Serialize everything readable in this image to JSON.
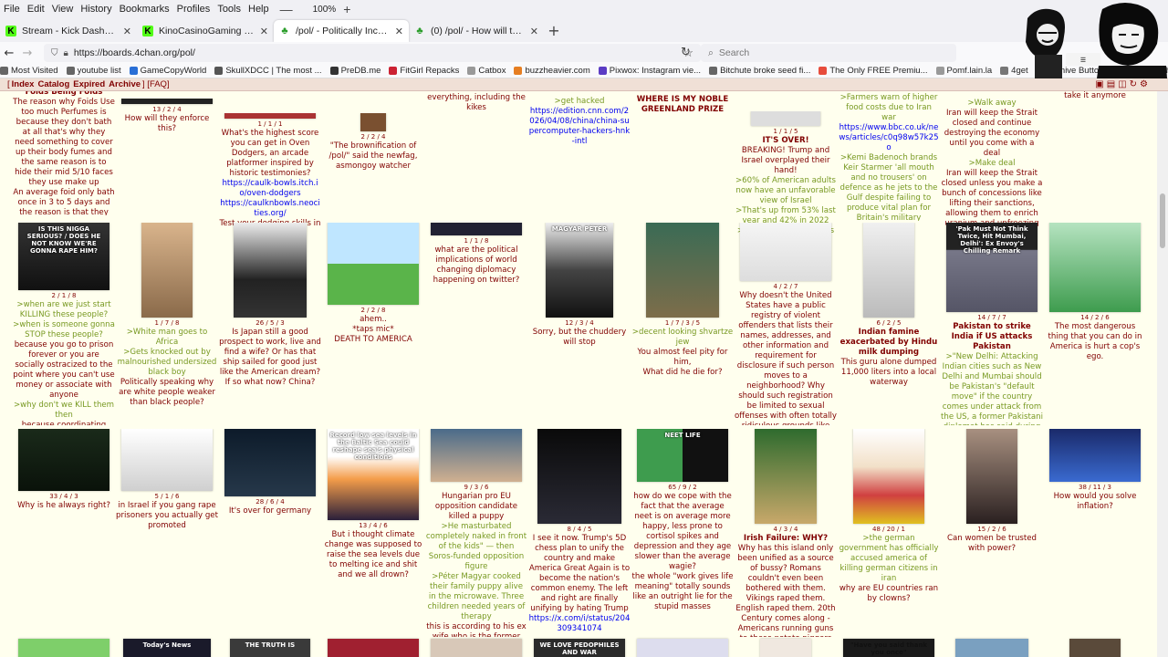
{
  "menubar": {
    "items": [
      "File",
      "Edit",
      "View",
      "History",
      "Bookmarks",
      "Profiles",
      "Tools",
      "Help"
    ],
    "zoom": "100%",
    "zoom_plus": "+"
  },
  "tabs": [
    {
      "title": "Stream - Kick Dashboard",
      "icon": "kick-icon"
    },
    {
      "title": "KinoCasinoGaming - Watch the",
      "icon": "kick-icon"
    },
    {
      "title": "/pol/ - Politically Incorrect - 4ch",
      "icon": "clover-icon",
      "active": true
    },
    {
      "title": "(0) /pol/ - How will they enforce",
      "icon": "clover-icon"
    }
  ],
  "newtab": "+",
  "navbar": {
    "url": "https://boards.4chan.org/pol/",
    "search_placeholder": "Search"
  },
  "bookmarks": [
    {
      "label": "Most Visited",
      "color": "#666666"
    },
    {
      "label": "youtube list",
      "color": "#666666"
    },
    {
      "label": "GameCopyWorld",
      "color": "#2a6fd6"
    },
    {
      "label": "SkullXDCC | The most ...",
      "color": "#555555"
    },
    {
      "label": "PreDB.me",
      "color": "#333333"
    },
    {
      "label": "FitGirl Repacks",
      "color": "#c23"
    },
    {
      "label": "Catbox",
      "color": "#999"
    },
    {
      "label": "buzzheavier.com",
      "color": "#e67e22"
    },
    {
      "label": "Pixwox: Instagram vie...",
      "color": "#5b3cc4"
    },
    {
      "label": "Bitchute broke seed fi...",
      "color": "#666"
    },
    {
      "label": "The Only FREE Premiu...",
      "color": "#e74c3c"
    },
    {
      "label": "Pomf.lain.la",
      "color": "#999"
    },
    {
      "label": "4get",
      "color": "#777"
    },
    {
      "label": "Archive Buttons | Free ...",
      "color": "#c0392b"
    },
    {
      "label": "chon",
      "color": "#555"
    }
  ],
  "boardnav": {
    "open": "[",
    "links": [
      "Index",
      "Catalog",
      "Expired",
      "Archive"
    ],
    "sep": "] [",
    "faq": "FAQ",
    "close": "]"
  },
  "catalog": {
    "row1": [
      {
        "meta": "",
        "lines": [
          [
            "s",
            "Foids Being Foids"
          ],
          [
            "t",
            "The reason why Foids Use too much Perfumes is because they don't bath at all that's why they need something to cover up their body fumes and the same reason is to hide their mid 5/10 faces they use make up"
          ],
          [
            "t",
            "An average foid only bath once in 3 to 5 days and the reason is that they don't"
          ]
        ]
      },
      {
        "meta": "13 / 2 / 4",
        "lines": [
          [
            "t",
            "How will they enforce this?"
          ]
        ]
      },
      {
        "meta": "1 / 1 / 1",
        "lines": [
          [
            "t",
            "What's the highest score you can get in Oven Dodgers, an arcade platformer inspired by historic testimonies?"
          ],
          [
            "l",
            "https://caulk-bowls.itch.io/oven-dodgers"
          ],
          [
            "l",
            "https://caulknbowls.neocities.org/"
          ],
          [
            "t",
            "Test your dodging skills in"
          ]
        ]
      },
      {
        "meta": "2 / 2 / 4",
        "lines": [
          [
            "t",
            "\"The brownification of /pol/\" said the newfag, asmongoy watcher"
          ]
        ]
      },
      {
        "meta": "",
        "lines": [
          [
            "t",
            "everything, including the kikes"
          ]
        ]
      },
      {
        "meta": "",
        "lines": [
          [
            "g",
            ">get hacked"
          ],
          [
            "l",
            "https://edition.cnn.com/2026/04/08/china/china-supercomputer-hackers-hnk-intl"
          ]
        ]
      },
      {
        "meta": "",
        "lines": [
          [
            "s",
            "WHERE IS MY NOBLE GREENLAND PRIZE"
          ]
        ]
      },
      {
        "meta": "1 / 1 / 5",
        "lines": [
          [
            "s",
            "IT'S OVER!"
          ],
          [
            "t",
            "BREAKING! Trump and Israel overplayed their hand!"
          ],
          [
            "g",
            ">60% of American adults now have an unfavorable view of Israel"
          ],
          [
            "g",
            ">That's up from 53% last year and 42% in 2022"
          ],
          [
            "g",
            ">In both political parties"
          ]
        ]
      },
      {
        "meta": "",
        "lines": [
          [
            "g",
            ">Farmers warn of higher food costs due to Iran war"
          ],
          [
            "l",
            "https://www.bbc.co.uk/news/articles/c0q98w57k25o"
          ],
          [
            "g",
            ">Kemi Badenoch brands Keir Starmer 'all mouth and no trousers' on defence as he jets to the Gulf despite failing to produce vital plan for Britain's military"
          ],
          [
            "l",
            "https://www.dailymail.co.uk/news/"
          ]
        ]
      },
      {
        "meta": "",
        "lines": [
          [
            "g",
            ">Walk away"
          ],
          [
            "t",
            "Iran will keep the Strait closed and continue destroying the economy until you come with a deal"
          ],
          [
            "g",
            ">Make deal"
          ],
          [
            "t",
            "Iran will keep the Strait closed unless you make a bunch of concessions like lifting their sanctions, allowing them to enrich uranium and unfreezing"
          ]
        ]
      },
      {
        "meta": "",
        "lines": [
          [
            "t",
            "take it anymore"
          ]
        ]
      }
    ],
    "row2": [
      {
        "meta": "2 / 1 / 8",
        "thumb_text": "IS THIS NIGGA SERIOUS? / DOES HE NOT KNOW WE'RE GONNA RAPE HIM?",
        "lines": [
          [
            "g",
            ">when are we just start KILLING these people?"
          ],
          [
            "g",
            ">when is someone gonna STOP these people?"
          ],
          [
            "t",
            "because you go to prison forever or you are socially ostracized to the point where you can't use money or associate with anyone"
          ],
          [
            "g",
            ">why don't we KILL them then"
          ],
          [
            "t",
            "because coordinating"
          ]
        ]
      },
      {
        "meta": "1 / 7 / 8",
        "thumb_text": "",
        "lines": [
          [
            "g",
            ">White man goes to Africa"
          ],
          [
            "g",
            ">Gets knocked out by malnourished undersized black boy"
          ],
          [
            "t",
            "Politically speaking why are white people weaker than black people?"
          ]
        ]
      },
      {
        "meta": "26 / 5 / 3",
        "thumb_text": "",
        "lines": [
          [
            "t",
            "Is Japan still a good prospect to work, live and find a wife? Or has that ship sailed for good just like the American dream? If so what now? China?"
          ]
        ]
      },
      {
        "meta": "2 / 2 / 8",
        "thumb_text": "",
        "lines": [
          [
            "t",
            "ahem.."
          ],
          [
            "t",
            "*taps mic*"
          ],
          [
            "t",
            "DEATH TO AMERICA"
          ]
        ]
      },
      {
        "meta": "1 / 1 / 8",
        "thumb_text": "",
        "lines": [
          [
            "t",
            "what are the political implications of world changing diplomacy happening on twitter?"
          ]
        ]
      },
      {
        "meta": "12 / 3 / 4",
        "thumb_text": "MAGYAR PÉTER",
        "lines": [
          [
            "t",
            "Sorry, but the chuddery will stop"
          ]
        ]
      },
      {
        "meta": "1 / 7 / 3 / 5",
        "thumb_text": "",
        "lines": [
          [
            "g",
            ">decent looking shvartze jew"
          ],
          [
            "t",
            "You almost feel pity for him,"
          ],
          [
            "t",
            "What did he die for?"
          ]
        ]
      },
      {
        "meta": "4 / 2 / 7",
        "thumb_text": "",
        "lines": [
          [
            "t",
            "Why doesn't the United States have a public registry of violent offenders that lists their names, addresses, and other information and requirement for disclosure if such person moves to a neighborhood? Why should such registration be limited to sexual offenses with often totally ridiculous grounds like teens fucking"
          ]
        ]
      },
      {
        "meta": "6 / 2 / 5",
        "thumb_text": "",
        "lines": [
          [
            "s",
            "Indian famine exacerbated by Hindu milk dumping"
          ],
          [
            "t",
            "This guru alone dumped 11,000 liters into a local waterway"
          ]
        ]
      },
      {
        "meta": "14 / 7 / 7",
        "thumb_text": "'Pak Must Not Think Twice, Hit Mumbai, Delhi': Ex Envoy's Chilling Remark",
        "lines": [
          [
            "s",
            "Pakistan to strike India if US attacks Pakistan"
          ],
          [
            "g",
            ">\"New Delhi: Attacking Indian cities such as New Delhi and Mumbai should be Pakistan's \"default move\" if the country comes under attack from the US, a former Pakistani diplomat has said during a TV show"
          ]
        ]
      },
      {
        "meta": "14 / 2 / 6",
        "thumb_text": "",
        "lines": [
          [
            "t",
            "The most dangerous thing that you can do in America is hurt a cop's ego."
          ]
        ]
      }
    ],
    "row3": [
      {
        "meta": "33 / 4 / 3",
        "thumb_text": "",
        "lines": [
          [
            "t",
            "Why is he always right?"
          ]
        ]
      },
      {
        "meta": "5 / 1 / 6",
        "thumb_text": "",
        "lines": [
          [
            "t",
            "in Israel if you gang rape prisoners you actually get promoted"
          ]
        ]
      },
      {
        "meta": "28 / 6 / 4",
        "thumb_text": "",
        "lines": [
          [
            "t",
            "It's over for germany"
          ]
        ]
      },
      {
        "meta": "13 / 4 / 6",
        "thumb_text": "Record low sea levels in the Baltic Sea could reshape sea's physical conditions",
        "lines": [
          [
            "t",
            "But i thought climate change was supposed to raise the sea levels due to melting ice and shit and we all drown?"
          ]
        ]
      },
      {
        "meta": "9 / 3 / 6",
        "thumb_text": "",
        "lines": [
          [
            "t",
            "Hungarian pro EU opposition candidate killed a puppy"
          ],
          [
            "g",
            ">He masturbated completely naked in front of the kids\" — then Soros-funded opposition figure"
          ],
          [
            "g",
            ">Péter Magyar cooked their family puppy alive in the microwave. Three children needed years of therapy"
          ],
          [
            "t",
            "this is according to his ex wife who is the former"
          ]
        ]
      },
      {
        "meta": "8 / 4 / 5",
        "thumb_text": "",
        "lines": [
          [
            "t",
            "I see it now. Trump's 5D chess plan to unify the country and make America Great Again is to become the nation's common enemy. The left and right are finally unifying by hating Trump"
          ],
          [
            "l",
            "https://x.com/i/status/204309341074"
          ]
        ]
      },
      {
        "meta": "65 / 9 / 2",
        "thumb_text": "NEET LIFE",
        "lines": [
          [
            "t",
            "how do we cope with the fact that the average neet is on average more happy, less prone to cortisol spikes and depression and they age slower than the average wagie?"
          ],
          [
            "t",
            "the whole \"work gives life meaning\" totally sounds like an outright lie for the stupid masses"
          ]
        ]
      },
      {
        "meta": "4 / 3 / 4",
        "thumb_text": "",
        "lines": [
          [
            "s",
            "Irish Failure: WHY?"
          ],
          [
            "t",
            "Why has this island only been unified as a source of bussy? Romans couldn't even been bothered with them. Vikings raped them. English raped them. 20th Century comes along - Americans running guns to these potato niggers"
          ]
        ]
      },
      {
        "meta": "48 / 20 / 1",
        "thumb_text": "",
        "lines": [
          [
            "g",
            ">the german government has officially accused america of killing german citizens in iran"
          ],
          [
            "t",
            "why are EU countries ran by clowns?"
          ]
        ]
      },
      {
        "meta": "15 / 2 / 6",
        "thumb_text": "",
        "lines": [
          [
            "t",
            "Can women be trusted with power?"
          ]
        ]
      },
      {
        "meta": "38 / 11 / 3",
        "thumb_text": "",
        "lines": [
          [
            "t",
            "How would you solve inflation?"
          ]
        ]
      }
    ],
    "row4_thumbs": [
      "Today's News",
      "THE TRUTH IS",
      "WE LOVE PEDOPHILES AND WAR",
      "\"Have you said thank you once\""
    ]
  }
}
